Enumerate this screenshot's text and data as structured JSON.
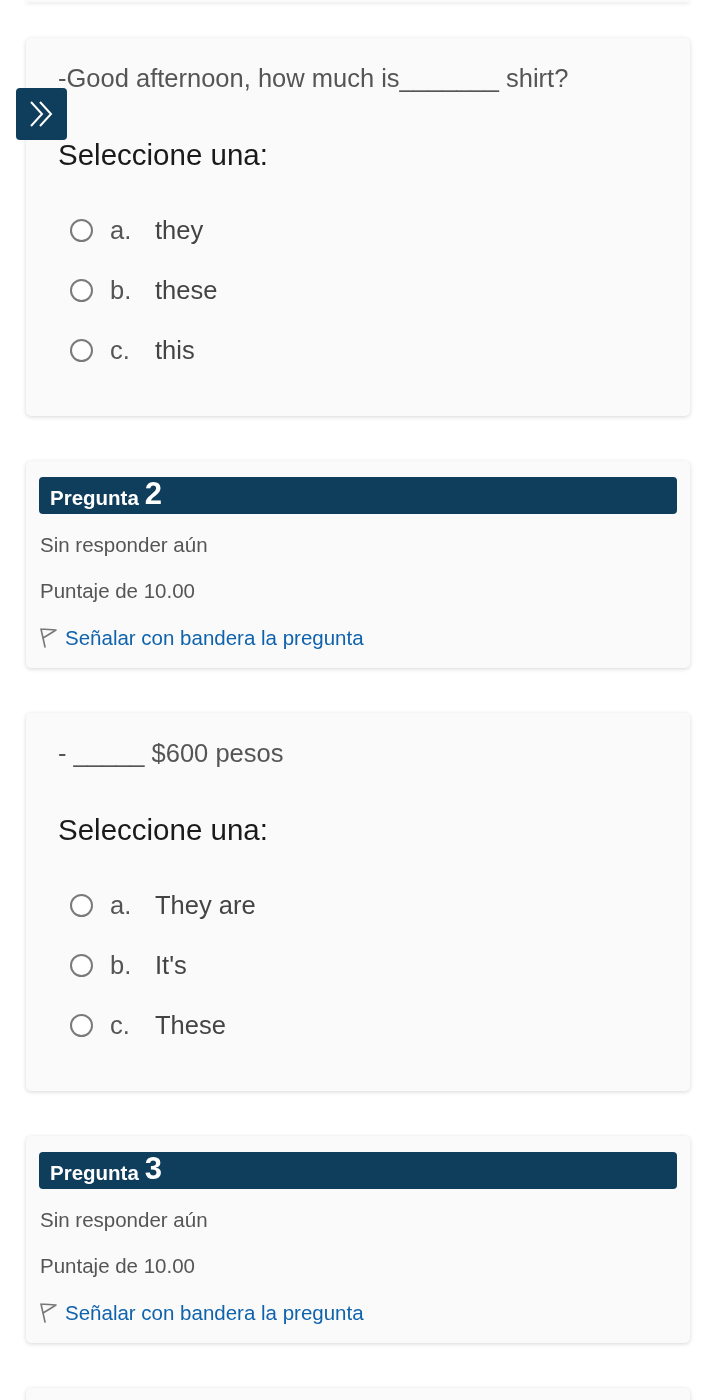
{
  "cards": [
    {
      "kind": "partial_top"
    },
    {
      "kind": "question",
      "prompt": "-Good afternoon, how much is_______ shirt?",
      "instruction": "Seleccione una:",
      "options": [
        {
          "letter": "a.",
          "text": "they",
          "selected": false
        },
        {
          "letter": "b.",
          "text": "these",
          "selected": false
        },
        {
          "letter": "c.",
          "text": "this",
          "selected": false
        }
      ]
    },
    {
      "kind": "info",
      "label": "Pregunta",
      "number": "2",
      "status": "Sin responder aún",
      "score": "Puntaje de 10.00",
      "flag_link": "Señalar con bandera la pregunta"
    },
    {
      "kind": "question",
      "prompt": "- _____ $600 pesos",
      "instruction": "Seleccione una:",
      "options": [
        {
          "letter": "a.",
          "text": "They are",
          "selected": false
        },
        {
          "letter": "b.",
          "text": "It's",
          "selected": false
        },
        {
          "letter": "c.",
          "text": "These",
          "selected": false
        }
      ]
    },
    {
      "kind": "info",
      "label": "Pregunta",
      "number": "3",
      "status": "Sin responder aún",
      "score": "Puntaje de 10.00",
      "flag_link": "Señalar con bandera la pregunta"
    },
    {
      "kind": "partial_bottom"
    }
  ]
}
